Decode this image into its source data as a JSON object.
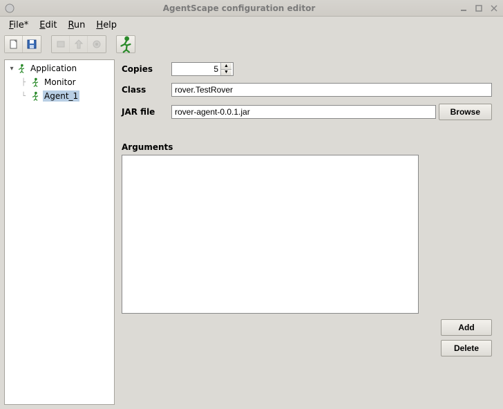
{
  "window": {
    "title": "AgentScape configuration editor"
  },
  "menu": {
    "file": "File*",
    "edit": "Edit",
    "run": "Run",
    "help": "Help"
  },
  "tree": {
    "root_label": "Application",
    "children": [
      {
        "label": "Monitor",
        "selected": false
      },
      {
        "label": "Agent_1",
        "selected": true
      }
    ]
  },
  "form": {
    "copies_label": "Copies",
    "copies_value": "5",
    "class_label": "Class",
    "class_value": "rover.TestRover",
    "jarfile_label": "JAR file",
    "jarfile_value": "rover-agent-0.0.1.jar",
    "browse_label": "Browse",
    "arguments_label": "Arguments",
    "arguments_value": "",
    "add_label": "Add",
    "delete_label": "Delete"
  }
}
